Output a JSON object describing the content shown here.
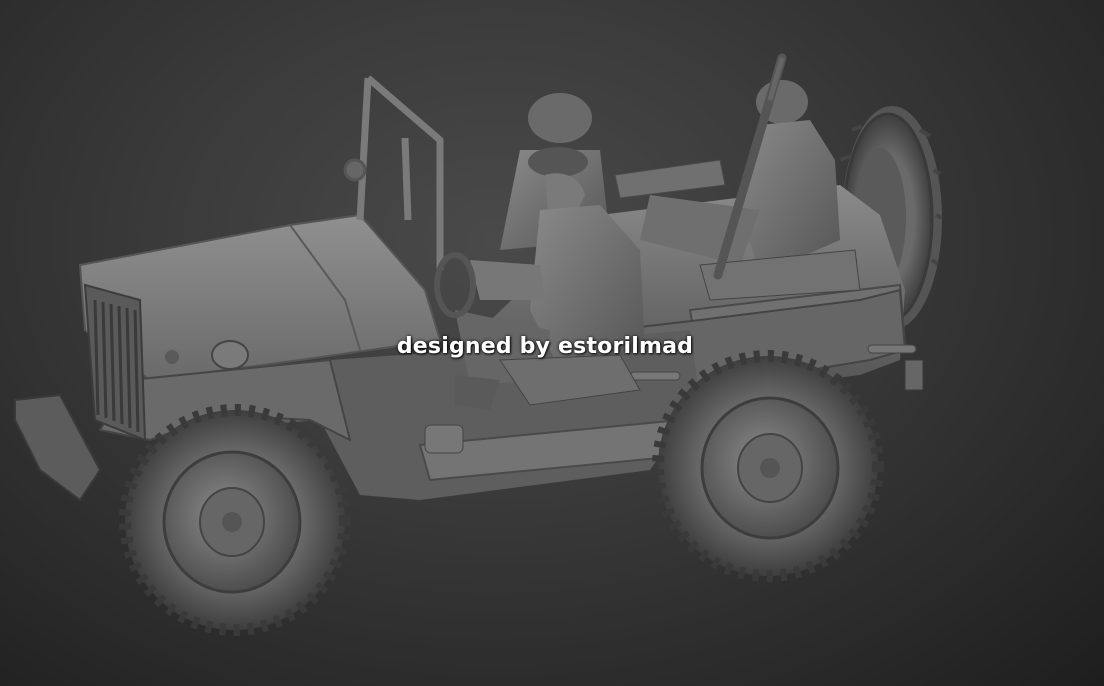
{
  "watermark": "designed by estorilmad",
  "colors": {
    "background": "#2e2e2e",
    "model": "#6e6e6e",
    "watermark": "#ffffff"
  }
}
